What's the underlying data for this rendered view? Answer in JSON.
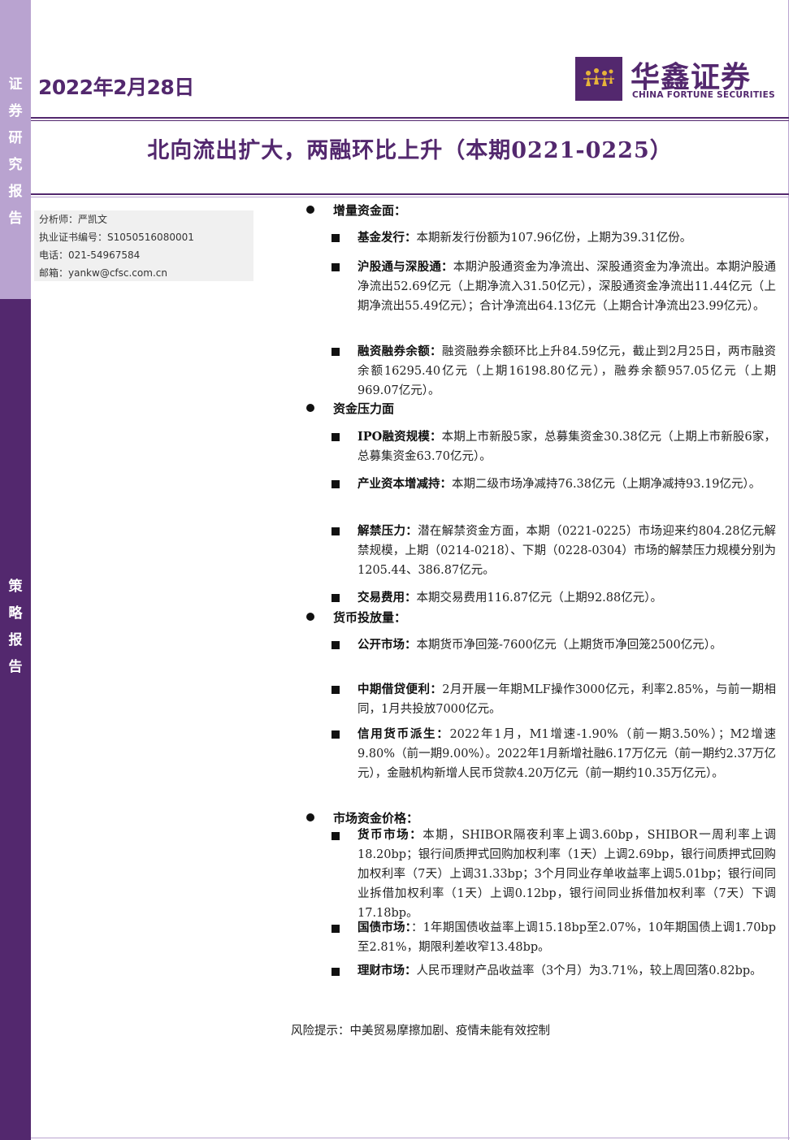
{
  "sidebar": {
    "top_label": [
      "证",
      "券",
      "研",
      "究",
      "报",
      "告"
    ],
    "bottom_label": [
      "策",
      "略",
      "报",
      "告"
    ]
  },
  "header": {
    "date": "2022年2月28日",
    "logo_cn": "华鑫证券",
    "logo_en": "CHINA FORTUNE SECURITIES"
  },
  "title": "北向流出扩大，两融环比上升（本期0221-0225）",
  "analyst": {
    "name": "分析师：严凯文",
    "cert": "执业证书编号：S1050516080001",
    "phone": "电话：021-54967584",
    "email": "邮箱：yankw@cfsc.com.cn"
  },
  "sections": [
    {
      "heading": "增量资金面：",
      "items": [
        {
          "label": "基金发行：",
          "text": "本期新发行份额为107.96亿份，上期为39.31亿份。"
        },
        {
          "label": "沪股通与深股通：",
          "text": "本期沪股通资金为净流出、深股通资金为净流出。本期沪股通净流出52.69亿元（上期净流入31.50亿元），深股通资金净流出11.44亿元（上期净流出55.49亿元）；合计净流出64.13亿元（上期合计净流出23.99亿元）。"
        },
        {
          "label": "融资融券余额：",
          "text": "融资融券余额环比上升84.59亿元，截止到2月25日，两市融资余额16295.40亿元（上期16198.80亿元），融券余额957.05亿元（上期969.07亿元）。"
        }
      ]
    },
    {
      "heading": "资金压力面",
      "items": [
        {
          "label": "IPO融资规模：",
          "text": "本期上市新股5家，总募集资金30.38亿元（上期上市新股6家，总募集资金63.70亿元）。"
        },
        {
          "label": "产业资本增减持：",
          "text": "本期二级市场净减持76.38亿元（上期净减持93.19亿元）。"
        },
        {
          "label": "解禁压力：",
          "text": "潜在解禁资金方面，本期（0221-0225）市场迎来约804.28亿元解禁规模，上期（0214-0218）、下期（0228-0304）市场的解禁压力规模分别为1205.44、386.87亿元。"
        },
        {
          "label": "交易费用：",
          "text": "本期交易费用116.87亿元（上期92.88亿元）。"
        }
      ]
    },
    {
      "heading": "货币投放量：",
      "items": [
        {
          "label": "公开市场：",
          "text": "本期货币净回笼-7600亿元（上期货币净回笼2500亿元）。"
        },
        {
          "label": "中期借贷便利：",
          "text": "2月开展一年期MLF操作3000亿元，利率2.85%，与前一期相同，1月共投放7000亿元。"
        },
        {
          "label": "信用货币派生：",
          "text": "2022年1月，M1增速-1.90%（前一期3.50%）；M2增速9.80%（前一期9.00%）。2022年1月新增社融6.17万亿元（前一期约2.37万亿元），金融机构新增人民币贷款4.20万亿元（前一期约10.35万亿元）。"
        }
      ]
    },
    {
      "heading": "市场资金价格：",
      "items": [
        {
          "label": "货币市场：",
          "text": "本期，SHIBOR隔夜利率上调3.60bp，SHIBOR一周利率上调18.20bp；银行间质押式回购加权利率（1天）上调2.69bp，银行间质押式回购加权利率（7天）上调31.33bp；3个月同业存单收益率上调5.01bp；银行间同业拆借加权利率（1天）上调0.12bp，银行间同业拆借加权利率（7天）下调17.18bp。"
        },
        {
          "label": "国债市场：",
          "text": "：1年期国债收益率上调15.18bp至2.07%，10年期国债上调1.70bp至2.81%，期限利差收窄13.48bp。"
        },
        {
          "label": "理财市场：",
          "text": "人民币理财产品收益率（3个月）为3.71%，较上周回落0.82bp。"
        }
      ]
    }
  ],
  "risk": "风险提示：中美贸易摩擦加剧、疫情未能有效控制",
  "colors": {
    "brand": "#53286e",
    "brand_light": "#b9a3d0"
  }
}
